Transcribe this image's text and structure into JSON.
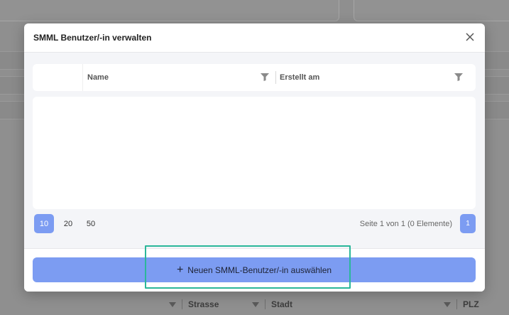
{
  "modal": {
    "title": "SMML Benutzer/-in verwalten",
    "close_icon": "close-icon"
  },
  "grid": {
    "columns": [
      {
        "label": "Name",
        "filter_icon": "filter-icon"
      },
      {
        "label": "Erstellt am",
        "filter_icon": "filter-icon"
      }
    ],
    "rows": []
  },
  "pager": {
    "sizes": [
      "10",
      "20",
      "50"
    ],
    "active_size": "10",
    "info": "Seite 1 von 1 (0 Elemente)",
    "current_page": "1"
  },
  "footer": {
    "add_label": "Neuen SMML-Benutzer/-in auswählen",
    "add_icon": "plus-icon"
  },
  "background": {
    "columns": [
      "Strasse",
      "Stadt",
      "PLZ"
    ]
  },
  "colors": {
    "accent": "#7c9cf2",
    "focus_ring": "#2bb79a",
    "overlay": "#8f8f8f"
  }
}
